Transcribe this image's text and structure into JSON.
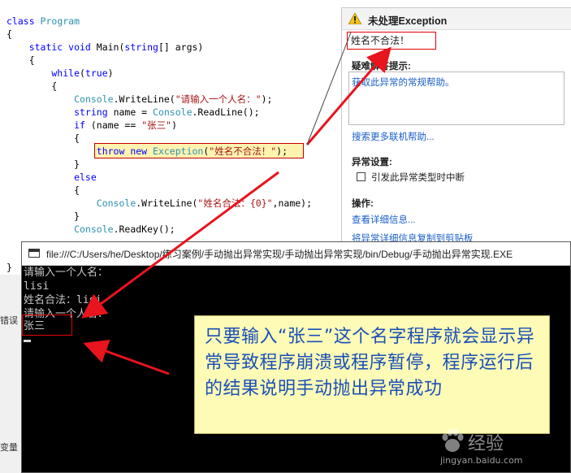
{
  "editor": {
    "lines": [
      {
        "parts": [
          {
            "t": "class ",
            "c": "kw"
          },
          {
            "t": "Program",
            "c": "ty"
          }
        ]
      },
      {
        "parts": [
          {
            "t": "{",
            "c": ""
          }
        ]
      },
      {
        "parts": [
          {
            "t": "    static void ",
            "c": "kw"
          },
          {
            "t": "Main(",
            "c": ""
          },
          {
            "t": "string",
            "c": "kw"
          },
          {
            "t": "[] args)",
            "c": ""
          }
        ]
      },
      {
        "parts": [
          {
            "t": "    {",
            "c": ""
          }
        ]
      },
      {
        "parts": [
          {
            "t": "        while",
            "c": "kw"
          },
          {
            "t": "(",
            "c": ""
          },
          {
            "t": "true",
            "c": "kw"
          },
          {
            "t": ")",
            "c": ""
          }
        ]
      },
      {
        "parts": [
          {
            "t": "        {",
            "c": ""
          }
        ]
      },
      {
        "parts": [
          {
            "t": "            ",
            "c": ""
          },
          {
            "t": "Console",
            "c": "ty"
          },
          {
            "t": ".WriteLine(",
            "c": ""
          },
          {
            "t": "\"请输入一个人名：\"",
            "c": "st"
          },
          {
            "t": ");",
            "c": ""
          }
        ]
      },
      {
        "parts": [
          {
            "t": "            ",
            "c": ""
          },
          {
            "t": "string",
            "c": "kw"
          },
          {
            "t": " name = ",
            "c": ""
          },
          {
            "t": "Console",
            "c": "ty"
          },
          {
            "t": ".ReadLine();",
            "c": ""
          }
        ]
      },
      {
        "parts": [
          {
            "t": "            ",
            "c": ""
          },
          {
            "t": "if",
            "c": "kw"
          },
          {
            "t": " (name == ",
            "c": ""
          },
          {
            "t": "\"张三\"",
            "c": "st"
          },
          {
            "t": ")",
            "c": ""
          }
        ]
      },
      {
        "parts": [
          {
            "t": "            {",
            "c": ""
          }
        ]
      },
      {
        "parts": [
          {
            "t": "                ",
            "c": ""
          },
          {
            "t": "throw new ",
            "c": "kw"
          },
          {
            "t": "Exception",
            "c": "ty"
          },
          {
            "t": "(",
            "c": ""
          },
          {
            "t": "\"姓名不合法！\"",
            "c": "st"
          },
          {
            "t": ");",
            "c": ""
          }
        ]
      },
      {
        "parts": [
          {
            "t": "            }",
            "c": ""
          }
        ]
      },
      {
        "parts": [
          {
            "t": "            else",
            "c": "kw"
          }
        ]
      },
      {
        "parts": [
          {
            "t": "            {",
            "c": ""
          }
        ]
      },
      {
        "parts": [
          {
            "t": "                ",
            "c": ""
          },
          {
            "t": "Console",
            "c": "ty"
          },
          {
            "t": ".WriteLine(",
            "c": ""
          },
          {
            "t": "\"姓名合法：{0}\"",
            "c": "st"
          },
          {
            "t": ",name);",
            "c": ""
          }
        ]
      },
      {
        "parts": [
          {
            "t": "            }",
            "c": ""
          }
        ]
      },
      {
        "parts": [
          {
            "t": "            ",
            "c": ""
          },
          {
            "t": "Console",
            "c": "ty"
          },
          {
            "t": ".ReadKey();",
            "c": ""
          }
        ]
      }
    ],
    "closing_brace": "}",
    "side_labels": [
      "错误",
      "变量"
    ]
  },
  "exception_popup": {
    "title": "未处理Exception",
    "message": "姓名不合法！",
    "tips_heading": "疑难解答提示:",
    "tips_link": "获取此异常的常规帮助。",
    "search_link": "搜索更多联机帮助...",
    "settings_heading": "异常设置:",
    "break_checkbox_label": "引发此异常类型时中断",
    "actions_heading": "操作:",
    "view_details_link": "查看详细信息...",
    "copy_details_link": "将异常详细信息复制到剪贴板"
  },
  "console": {
    "title": "file:///C:/Users/he/Desktop/练习案例/手动抛出异常实现/手动抛出异常实现/bin/Debug/手动抛出异常实现.EXE",
    "lines": [
      "请输入一个人名：",
      "lisi",
      "姓名合法：lisi",
      "请输入一个人名：",
      "张三"
    ]
  },
  "annotation": {
    "text": "只要输入“张三”这个名字程序就会显示异常导致程序崩溃或程序暂停，程序运行后的结果说明手动抛出异常成功"
  },
  "watermark": {
    "brand": "经验",
    "url": "jingyan.baidu.com"
  },
  "colors": {
    "arrow": "#e8141e",
    "annotation_text": "#1a4fb8",
    "annotation_bg": "#fdfbb6",
    "link": "#1a5fc8"
  }
}
